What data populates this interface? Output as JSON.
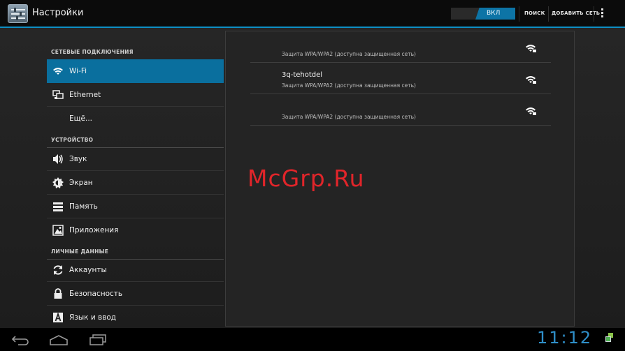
{
  "actionbar": {
    "title": "Настройки",
    "toggle_label": "ВКЛ",
    "search_label": "ПОИСК",
    "add_network_label": "ДОБАВИТЬ СЕТЬ",
    "accent_color": "#0e8fc4"
  },
  "sidebar": {
    "sections": [
      {
        "header": "СЕТЕВЫЕ ПОДКЛЮЧЕНИЯ",
        "items": [
          {
            "label": "Wi-Fi",
            "icon": "wifi-icon",
            "selected": true
          },
          {
            "label": "Ethernet",
            "icon": "ethernet-icon"
          },
          {
            "label": "Ещё...",
            "icon": ""
          }
        ]
      },
      {
        "header": "УСТРОЙСТВО",
        "items": [
          {
            "label": "Звук",
            "icon": "speaker-icon"
          },
          {
            "label": "Экран",
            "icon": "brightness-icon"
          },
          {
            "label": "Память",
            "icon": "storage-icon"
          },
          {
            "label": "Приложения",
            "icon": "apps-icon"
          }
        ]
      },
      {
        "header": "ЛИЧНЫЕ ДАННЫЕ",
        "items": [
          {
            "label": "Аккаунты",
            "icon": "sync-icon"
          },
          {
            "label": "Безопасность",
            "icon": "lock-icon"
          },
          {
            "label": "Язык и ввод",
            "icon": "keyboard-icon"
          }
        ]
      }
    ]
  },
  "networks": [
    {
      "ssid": "",
      "security": "Защита WPA/WPA2 (доступна защищенная сеть)",
      "icon": "wifi-lock-icon"
    },
    {
      "ssid": "3q-tehotdel",
      "security": "Защита WPA/WPA2 (доступна защищенная сеть)",
      "icon": "wifi-lock-icon"
    },
    {
      "ssid": "",
      "security": "Защита WPA/WPA2 (доступна защищенная сеть)",
      "icon": "wifi-lock-icon"
    }
  ],
  "watermark": "McGrp.Ru",
  "sysbar": {
    "clock": "11:12",
    "clock_color": "#2f8fc9"
  }
}
